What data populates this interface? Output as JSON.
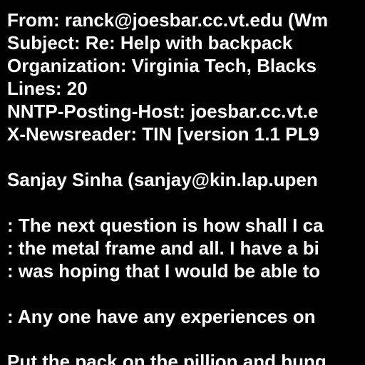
{
  "header": {
    "from": "From: ranck@joesbar.cc.vt.edu (Wm",
    "subject": "Subject: Re: Help with backpack",
    "organization": "Organization: Virginia Tech, Blacks",
    "lines": "Lines: 20",
    "nntp_host": "NNTP-Posting-Host: joesbar.cc.vt.e",
    "newsreader": "X-Newsreader: TIN [version 1.1 PL9"
  },
  "body": {
    "attribution": "Sanjay Sinha (sanjay@kin.lap.upen",
    "quote_1": ": The next question is how shall I ca",
    "quote_2": ": the metal frame and all. I have a bi",
    "quote_3": ": was hoping that I would be able to",
    "quote_4": ": Any one have any experiences on",
    "reply_1": "Put the pack on the pillion and bung"
  },
  "colors": {
    "background": "#000000",
    "text": "#ffffff"
  }
}
